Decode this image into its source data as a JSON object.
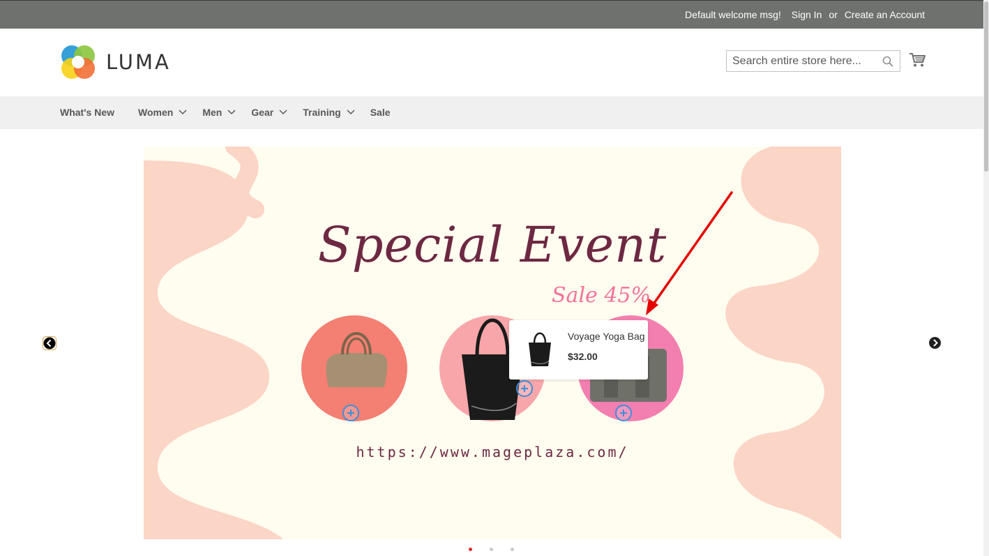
{
  "topbar": {
    "welcome": "Default welcome msg!",
    "sign_in": "Sign In",
    "or": "or",
    "create_account": "Create an Account"
  },
  "header": {
    "logo_text": "LUMA",
    "search_placeholder": "Search entire store here...",
    "icons": {
      "search": "search-icon",
      "cart": "cart-icon"
    }
  },
  "nav": {
    "items": [
      {
        "label": "What's New",
        "has_submenu": false
      },
      {
        "label": "Women",
        "has_submenu": true
      },
      {
        "label": "Men",
        "has_submenu": true
      },
      {
        "label": "Gear",
        "has_submenu": true
      },
      {
        "label": "Training",
        "has_submenu": true
      },
      {
        "label": "Sale",
        "has_submenu": false
      }
    ]
  },
  "banner": {
    "title": "Special Event",
    "sale": "Sale 45%",
    "url": "https://www.mageplaza.com/"
  },
  "tooltip": {
    "product_name": "Voyage Yoga Bag",
    "price": "$32.00"
  },
  "carousel": {
    "slide_count": 3,
    "active_slide": 1
  },
  "colors": {
    "topbar": "#6e716e",
    "nav_bg": "#f0f0f0",
    "title": "#6d2842",
    "sale": "#f4729a",
    "hotspot": "#3d8fd8",
    "annotation_arrow": "#e60000"
  }
}
